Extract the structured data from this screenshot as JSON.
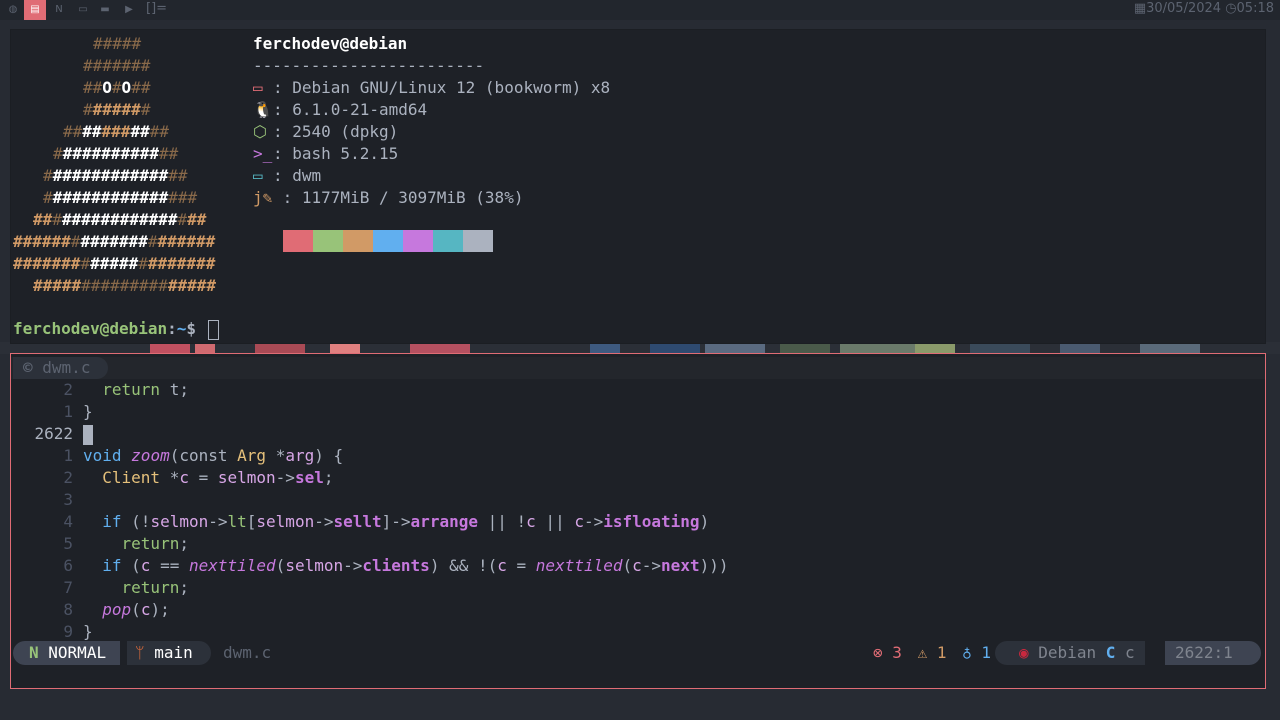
{
  "topbar": {
    "tags": [
      {
        "icon": "globe-icon",
        "glyph": "◍",
        "active": false
      },
      {
        "icon": "file-icon",
        "glyph": "▤",
        "active": true
      },
      {
        "icon": "neovim-icon",
        "glyph": "N",
        "active": false
      },
      {
        "icon": "chat-icon",
        "glyph": "▭",
        "active": false
      },
      {
        "icon": "folder-icon",
        "glyph": "▬",
        "active": false
      },
      {
        "icon": "video-icon",
        "glyph": "▶",
        "active": false
      }
    ],
    "layout_symbol": "[]=",
    "date": "30/05/2024",
    "time": "05:18"
  },
  "terminal": {
    "user": "ferchodev",
    "at": "@",
    "host": "debian",
    "separator": "------------------------",
    "info": [
      {
        "icon": "monitor-icon",
        "glyph": "▭",
        "value": ": Debian GNU/Linux 12 (bookworm) x8",
        "color": "#e06c75"
      },
      {
        "icon": "linux-icon",
        "glyph": "🐧",
        "value": ": 6.1.0-21-amd64",
        "color": "#abb2bf"
      },
      {
        "icon": "package-icon",
        "glyph": "⬡",
        "value": ": 2540 (dpkg)",
        "color": "#98c379"
      },
      {
        "icon": "terminal-icon",
        "glyph": ">_",
        "value": ": bash 5.2.15",
        "color": "#c678dd"
      },
      {
        "icon": "window-icon",
        "glyph": "▭",
        "value": ": dwm",
        "color": "#56b6c2"
      },
      {
        "icon": "memory-icon",
        "glyph": "j✎",
        "value": " : 1177MiB / 3097MiB (38%)",
        "color": "#d19a66"
      }
    ],
    "swatches": [
      "#e06c75",
      "#98c379",
      "#d19a66",
      "#61afef",
      "#c678dd",
      "#56b6c2",
      "#abb2bf"
    ],
    "prompt": {
      "user_host": "ferchodev@debian",
      "sep": ":",
      "path": "~",
      "symbol": "$ "
    }
  },
  "editor": {
    "tab": {
      "icon": "c-file-icon",
      "label": "dwm.c"
    },
    "lines": [
      {
        "num": "2",
        "cur": false,
        "code": [
          [
            "  ",
            "pu"
          ],
          [
            "return",
            "ret"
          ],
          [
            " t;",
            "pu"
          ]
        ]
      },
      {
        "num": "1",
        "cur": false,
        "code": [
          [
            "}",
            "pu"
          ]
        ]
      },
      {
        "num": "2622",
        "cur": true,
        "code": [
          [
            "",
            "pu"
          ]
        ]
      },
      {
        "num": "1",
        "cur": false,
        "code": [
          [
            "void",
            "kw"
          ],
          [
            " ",
            "pu"
          ],
          [
            "zoom",
            "fn"
          ],
          [
            "(",
            "pu"
          ],
          [
            "const",
            "pu"
          ],
          [
            " ",
            "pu"
          ],
          [
            "Arg",
            "ty"
          ],
          [
            " *",
            "pu"
          ],
          [
            "arg",
            "var"
          ],
          [
            ") {",
            "pu"
          ]
        ]
      },
      {
        "num": "2",
        "cur": false,
        "code": [
          [
            "  ",
            "pu"
          ],
          [
            "Client",
            "ty"
          ],
          [
            " *",
            "pu"
          ],
          [
            "c",
            "var"
          ],
          [
            " = ",
            "pu"
          ],
          [
            "selmon",
            "var"
          ],
          [
            "->",
            "pu"
          ],
          [
            "sel",
            "mem"
          ],
          [
            ";",
            "pu"
          ]
        ]
      },
      {
        "num": "3",
        "cur": false,
        "code": [
          [
            "",
            "pu"
          ]
        ]
      },
      {
        "num": "4",
        "cur": false,
        "code": [
          [
            "  ",
            "pu"
          ],
          [
            "if",
            "kw"
          ],
          [
            " (!",
            "pu"
          ],
          [
            "selmon",
            "var"
          ],
          [
            "->",
            "pu"
          ],
          [
            "lt",
            "lt"
          ],
          [
            "[",
            "pu"
          ],
          [
            "selmon",
            "var"
          ],
          [
            "->",
            "pu"
          ],
          [
            "sellt",
            "mem"
          ],
          [
            "]->",
            "pu"
          ],
          [
            "arrange",
            "mem"
          ],
          [
            " || !",
            "pu"
          ],
          [
            "c",
            "var"
          ],
          [
            " || ",
            "pu"
          ],
          [
            "c",
            "var"
          ],
          [
            "->",
            "pu"
          ],
          [
            "isfloating",
            "mem"
          ],
          [
            ")",
            "pu"
          ]
        ]
      },
      {
        "num": "5",
        "cur": false,
        "code": [
          [
            "    ",
            "pu"
          ],
          [
            "return",
            "ret"
          ],
          [
            ";",
            "pu"
          ]
        ]
      },
      {
        "num": "6",
        "cur": false,
        "code": [
          [
            "  ",
            "pu"
          ],
          [
            "if",
            "kw"
          ],
          [
            " (",
            "pu"
          ],
          [
            "c",
            "var"
          ],
          [
            " == ",
            "pu"
          ],
          [
            "nexttiled",
            "fn"
          ],
          [
            "(",
            "pu"
          ],
          [
            "selmon",
            "var"
          ],
          [
            "->",
            "pu"
          ],
          [
            "clients",
            "mem"
          ],
          [
            ") && !(",
            "pu"
          ],
          [
            "c",
            "var"
          ],
          [
            " = ",
            "pu"
          ],
          [
            "nexttiled",
            "fn"
          ],
          [
            "(",
            "pu"
          ],
          [
            "c",
            "var"
          ],
          [
            "->",
            "pu"
          ],
          [
            "next",
            "mem"
          ],
          [
            ")))",
            "pu"
          ]
        ]
      },
      {
        "num": "7",
        "cur": false,
        "code": [
          [
            "    ",
            "pu"
          ],
          [
            "return",
            "ret"
          ],
          [
            ";",
            "pu"
          ]
        ]
      },
      {
        "num": "8",
        "cur": false,
        "code": [
          [
            "  ",
            "pu"
          ],
          [
            "pop",
            "fn"
          ],
          [
            "(",
            "pu"
          ],
          [
            "c",
            "var"
          ],
          [
            ");",
            "pu"
          ]
        ]
      },
      {
        "num": "9",
        "cur": false,
        "code": [
          [
            "}",
            "pu"
          ]
        ]
      }
    ],
    "status": {
      "mode_icon": "N",
      "mode": "NORMAL",
      "branch_icon": "ᛘ",
      "branch": "main",
      "file": "dwm.c",
      "errors": "3",
      "warnings": "1",
      "hints": "1",
      "os_icon": "◉",
      "os": "Debian",
      "lang_icon": "C",
      "lang": "c",
      "position": "2622:1"
    }
  }
}
